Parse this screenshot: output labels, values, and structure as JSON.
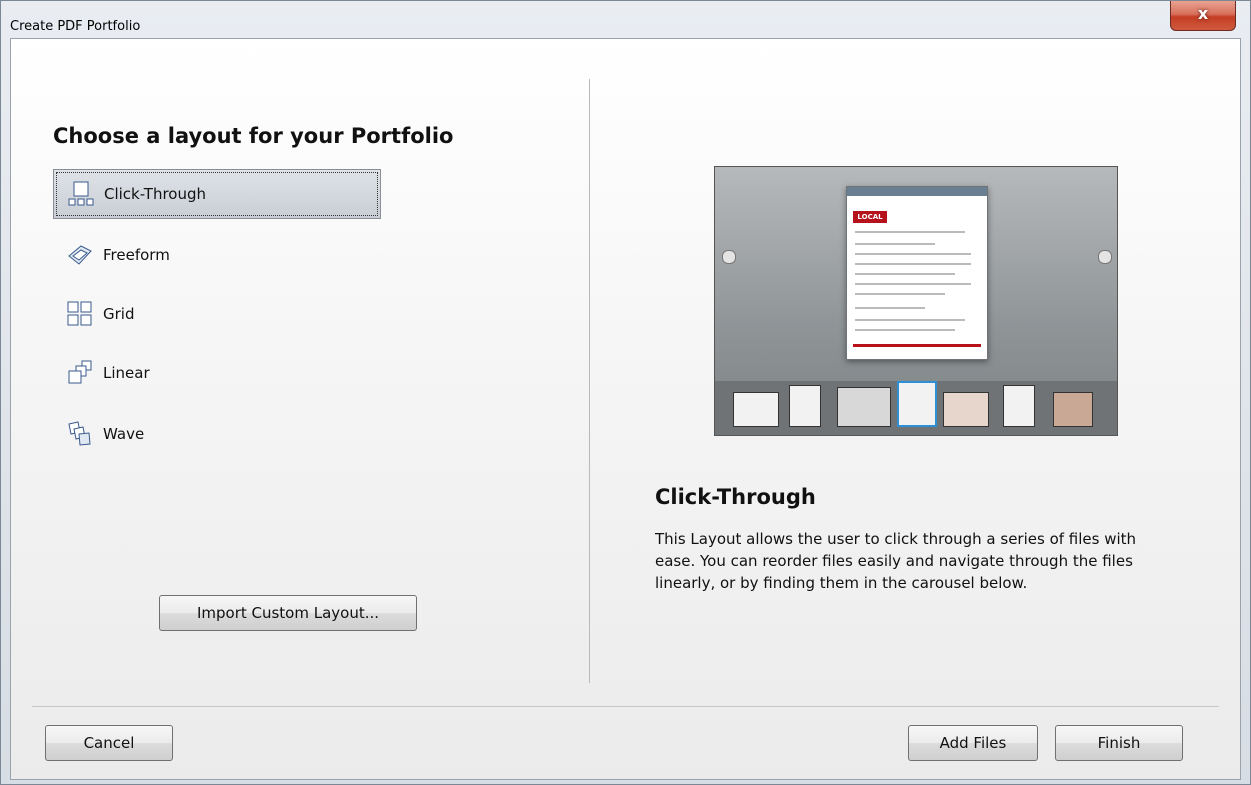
{
  "window": {
    "title": "Create PDF Portfolio",
    "close_symbol": "x"
  },
  "left": {
    "heading": "Choose a layout for your Portfolio",
    "layouts": [
      {
        "label": "Click-Through",
        "icon": "click-through-icon",
        "selected": true
      },
      {
        "label": "Freeform",
        "icon": "freeform-icon",
        "selected": false
      },
      {
        "label": "Grid",
        "icon": "grid-icon",
        "selected": false
      },
      {
        "label": "Linear",
        "icon": "linear-icon",
        "selected": false
      },
      {
        "label": "Wave",
        "icon": "wave-icon",
        "selected": false
      }
    ],
    "import_label": "Import Custom Layout..."
  },
  "right": {
    "preview_title": "Click-Through",
    "preview_description": "This Layout allows the user to click through a series of files with ease. You can reorder files easily and navigate through the files linearly, or by finding them in the carousel below.",
    "preview_doc_badge": "LOCAL"
  },
  "footer": {
    "cancel_label": "Cancel",
    "add_files_label": "Add Files",
    "finish_label": "Finish"
  },
  "colors": {
    "selected_border": "#8a8f96",
    "accent_red": "#b5121b",
    "close_red": "#c43d24"
  }
}
